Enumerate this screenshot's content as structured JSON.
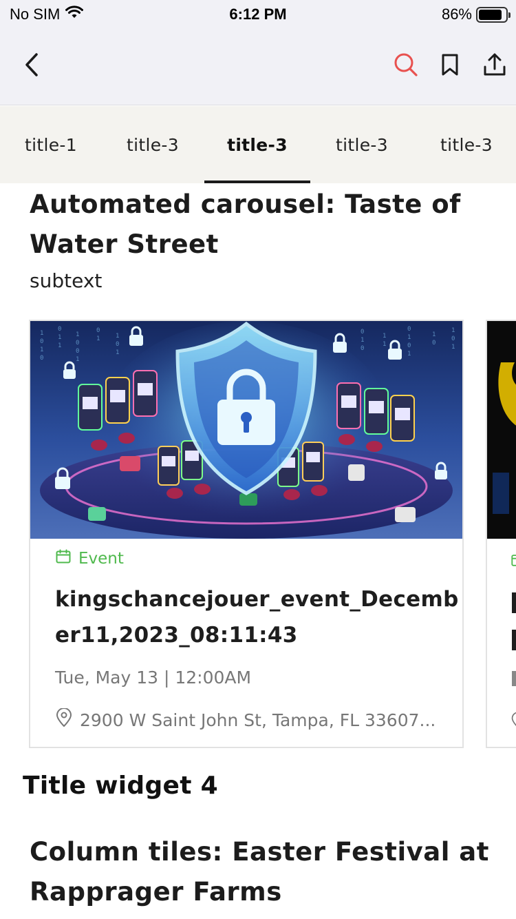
{
  "status_bar": {
    "carrier": "No SIM",
    "time": "6:12 PM",
    "battery_percent": "86%",
    "battery_level": 0.86,
    "wifi_icon": "wifi-icon",
    "battery_icon": "battery-icon"
  },
  "nav": {
    "back_icon": "chevron-left-icon",
    "search_icon": "search-icon",
    "bookmark_icon": "bookmark-icon",
    "share_icon": "share-icon",
    "search_color": "#e8514f"
  },
  "tabs": [
    {
      "label": "title-1",
      "active": false
    },
    {
      "label": "title-3",
      "active": false
    },
    {
      "label": "title-3",
      "active": true
    },
    {
      "label": "title-3",
      "active": false
    },
    {
      "label": "title-3",
      "active": false
    }
  ],
  "carousel": {
    "title": "Automated carousel: Taste of Water Street",
    "subtext": "subtext",
    "cards": [
      {
        "category": "Event",
        "category_icon": "calendar-icon",
        "category_color": "#4fb94d",
        "title": "kingschancejouer_event_December11,2023_08:11:43",
        "date": "Tue, May 13 | 12:00AM",
        "location": "2900 W Saint John St, Tampa, FL 33607...",
        "location_icon": "location-pin-icon",
        "image": "casino-security-illustration"
      }
    ]
  },
  "widgets": {
    "title_widget": "Title widget 4",
    "column_tiles_title": "Column tiles: Easter Festival at Rapprager Farms"
  }
}
